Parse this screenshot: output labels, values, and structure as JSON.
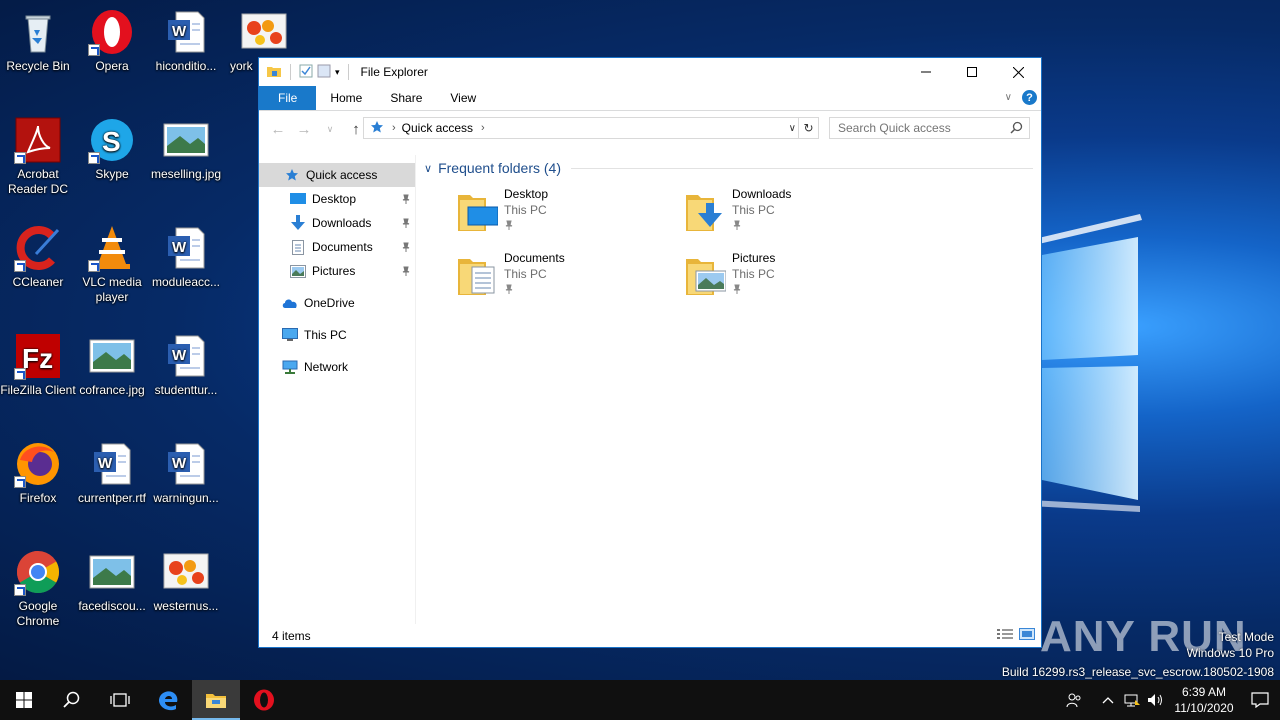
{
  "desktop": {
    "icons": [
      {
        "label": "Recycle Bin",
        "icon": "recycle-bin-icon"
      },
      {
        "label": "Opera",
        "icon": "opera-icon"
      },
      {
        "label": "hiconditio...",
        "icon": "word-document-icon"
      },
      {
        "label": "york",
        "icon": "image-flowers-icon"
      },
      {
        "label": "Acrobat Reader DC",
        "icon": "acrobat-icon"
      },
      {
        "label": "Skype",
        "icon": "skype-icon"
      },
      {
        "label": "meselling.jpg",
        "icon": "image-landscape-icon"
      },
      {
        "label": "CCleaner",
        "icon": "ccleaner-icon"
      },
      {
        "label": "VLC media player",
        "icon": "vlc-icon"
      },
      {
        "label": "moduleacc...",
        "icon": "word-document-icon"
      },
      {
        "label": "FileZilla Client",
        "icon": "filezilla-icon"
      },
      {
        "label": "cofrance.jpg",
        "icon": "image-landscape-icon"
      },
      {
        "label": "studenttur...",
        "icon": "word-document-icon"
      },
      {
        "label": "Firefox",
        "icon": "firefox-icon"
      },
      {
        "label": "currentper.rtf",
        "icon": "word-document-icon"
      },
      {
        "label": "warningun...",
        "icon": "word-document-icon"
      },
      {
        "label": "Google Chrome",
        "icon": "chrome-icon"
      },
      {
        "label": "facediscou...",
        "icon": "image-landscape-icon"
      },
      {
        "label": "westernus...",
        "icon": "image-flowers-icon"
      }
    ],
    "watermark": {
      "line1": "Test Mode",
      "line2": "Windows 10 Pro",
      "line3": "Build 16299.rs3_release_svc_escrow.180502-1908",
      "brand": "ANY RUN"
    }
  },
  "explorer": {
    "title": "File Explorer",
    "ribbon_tabs": [
      "File",
      "Home",
      "Share",
      "View"
    ],
    "address": {
      "crumb": "Quick access"
    },
    "search": {
      "placeholder": "Search Quick access"
    },
    "nav": {
      "quick_access": "Quick access",
      "pinned": [
        "Desktop",
        "Downloads",
        "Documents",
        "Pictures"
      ],
      "onedrive": "OneDrive",
      "this_pc": "This PC",
      "network": "Network"
    },
    "group": {
      "title": "Frequent folders (4)"
    },
    "folders": [
      {
        "name": "Desktop",
        "location": "This PC",
        "icon": "folder-desktop-icon"
      },
      {
        "name": "Downloads",
        "location": "This PC",
        "icon": "folder-downloads-icon"
      },
      {
        "name": "Documents",
        "location": "This PC",
        "icon": "folder-documents-icon"
      },
      {
        "name": "Pictures",
        "location": "This PC",
        "icon": "folder-pictures-icon"
      }
    ],
    "status": "4 items"
  },
  "taskbar": {
    "time": "6:39 AM",
    "date": "11/10/2020"
  },
  "colors": {
    "accent": "#1979ca",
    "selection": "#d9d9d9",
    "taskbar": "#101010"
  }
}
